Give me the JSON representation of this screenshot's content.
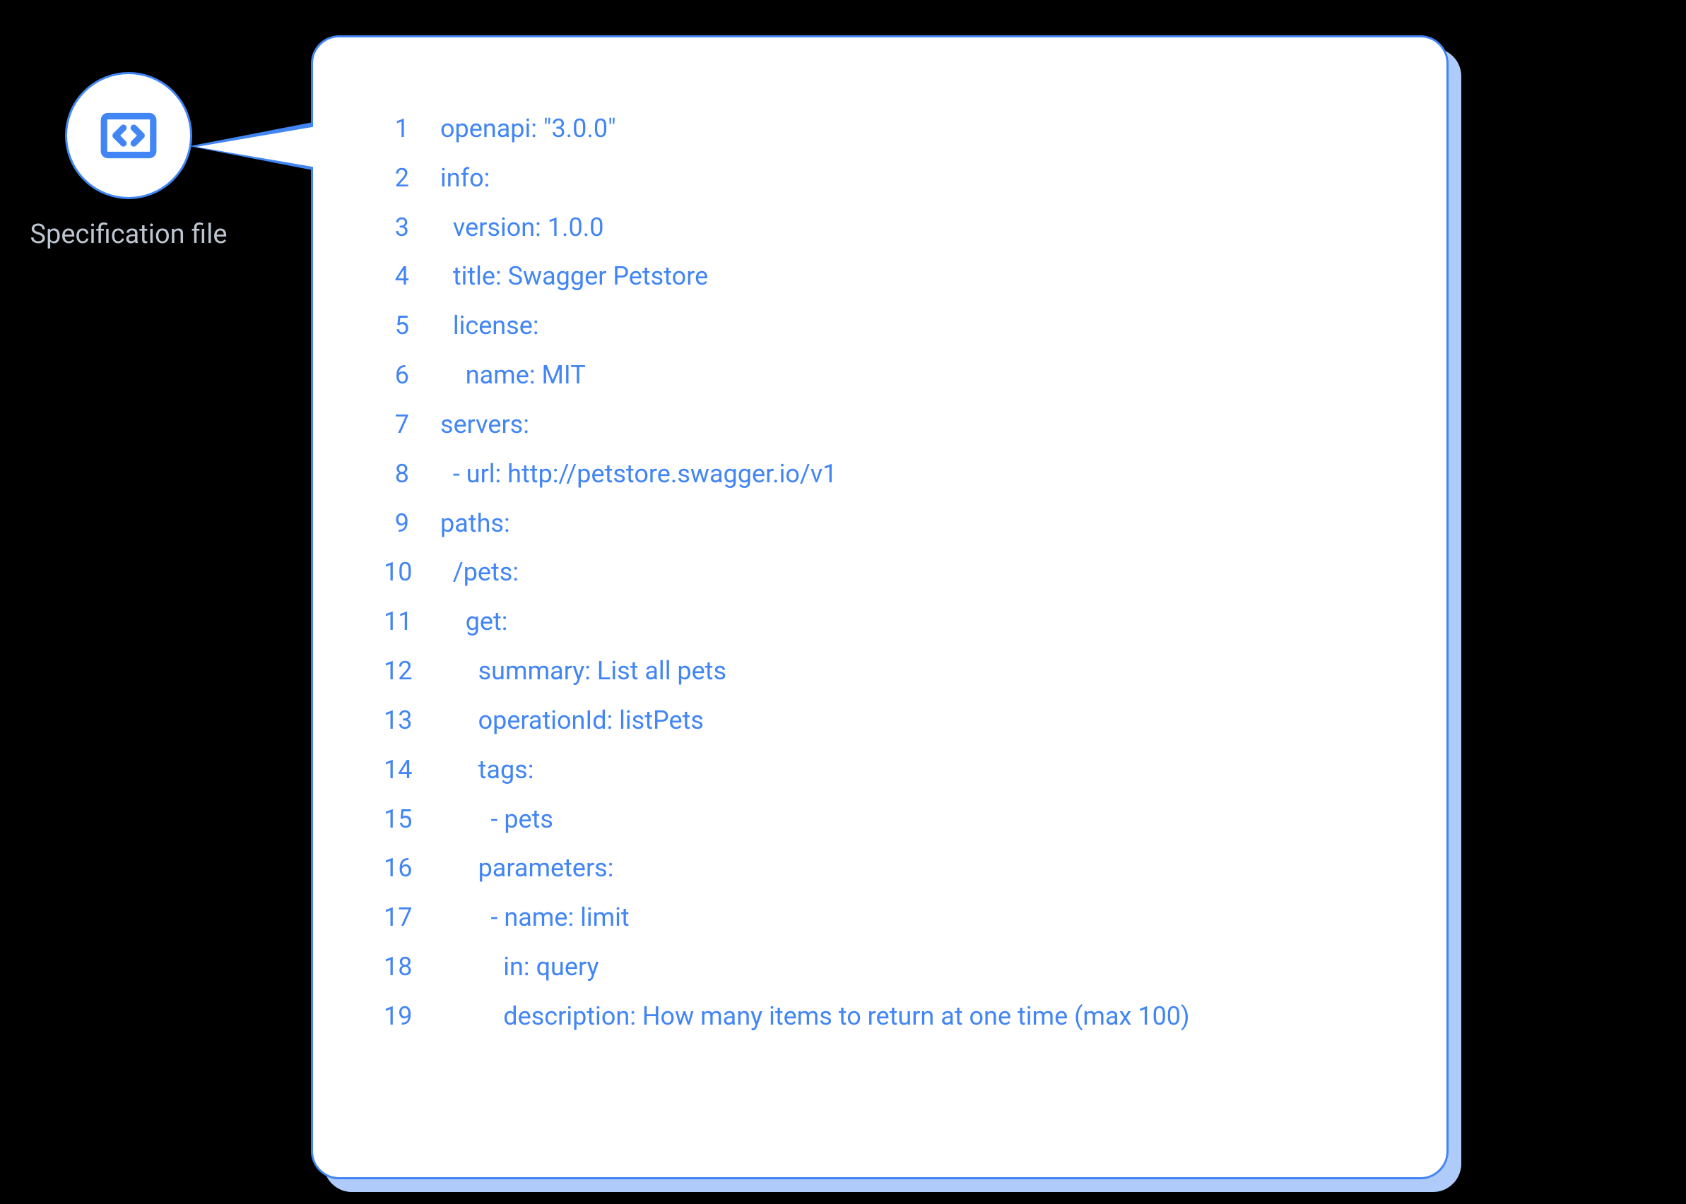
{
  "label": "Specification file",
  "code": {
    "lines": [
      {
        "num": "1",
        "text": "openapi: \"3.0.0\""
      },
      {
        "num": "2",
        "text": "info:"
      },
      {
        "num": "3",
        "text": "  version: 1.0.0"
      },
      {
        "num": "4",
        "text": "  title: Swagger Petstore"
      },
      {
        "num": "5",
        "text": "  license:"
      },
      {
        "num": "6",
        "text": "    name: MIT"
      },
      {
        "num": "7",
        "text": "servers:"
      },
      {
        "num": "8",
        "text": "  - url: http://petstore.swagger.io/v1"
      },
      {
        "num": "9",
        "text": "paths:"
      },
      {
        "num": "10",
        "text": "  /pets:"
      },
      {
        "num": "11",
        "text": "    get:"
      },
      {
        "num": "12",
        "text": "      summary: List all pets"
      },
      {
        "num": "13",
        "text": "      operationId: listPets"
      },
      {
        "num": "14",
        "text": "      tags:"
      },
      {
        "num": "15",
        "text": "        - pets"
      },
      {
        "num": "16",
        "text": "      parameters:"
      },
      {
        "num": "17",
        "text": "        - name: limit"
      },
      {
        "num": "18",
        "text": "          in: query"
      },
      {
        "num": "19",
        "text": "          description: How many items to return at one time (max 100)"
      }
    ]
  }
}
